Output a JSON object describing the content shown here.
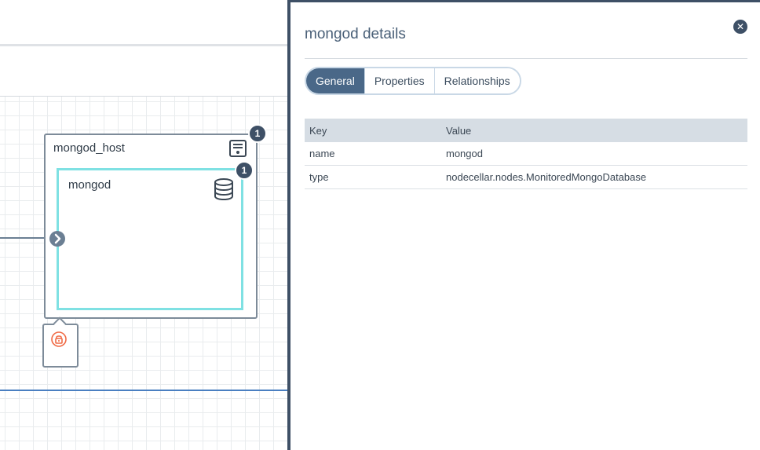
{
  "topology": {
    "host": {
      "label": "mongod_host",
      "icon": "server-icon",
      "badge": "1"
    },
    "node": {
      "label": "mongod",
      "icon": "database-icon",
      "badge": "1"
    },
    "connector": {
      "icon": "chevron-right-icon"
    },
    "policy": {
      "icon": "lock-icon",
      "color": "#f06a45"
    }
  },
  "panel": {
    "title": "mongod details",
    "close_icon": "close-icon",
    "tabs": [
      {
        "label": "General",
        "active": true
      },
      {
        "label": "Properties",
        "active": false
      },
      {
        "label": "Relationships",
        "active": false
      }
    ],
    "table": {
      "headers": [
        "Key",
        "Value"
      ],
      "rows": [
        {
          "key": "name",
          "value": "mongod"
        },
        {
          "key": "type",
          "value": "nodecellar.nodes.MonitoredMongoDatabase"
        }
      ]
    }
  },
  "colors": {
    "accent": "#3e5066",
    "node_border": "#7fe1e3",
    "tab_active": "#4a6888",
    "link_line": "#4a7fc1"
  }
}
